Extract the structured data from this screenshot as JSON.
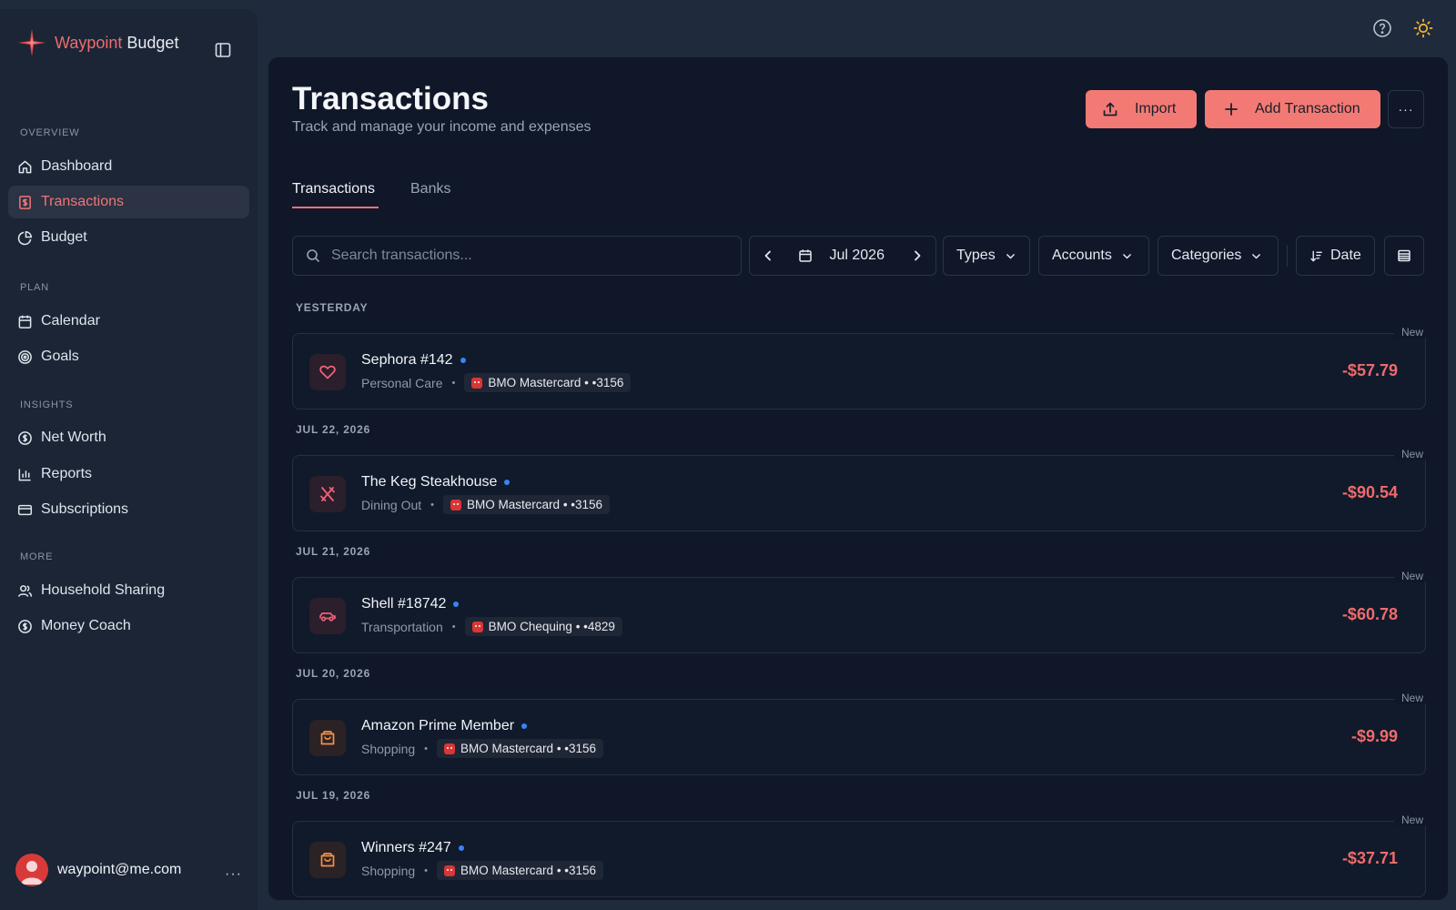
{
  "app": {
    "brand_first": "Waypoint",
    "brand_second": "Budget"
  },
  "sidebar": {
    "sections": [
      {
        "title": "OVERVIEW",
        "items": [
          {
            "label": "Dashboard",
            "icon": "home-icon"
          },
          {
            "label": "Transactions",
            "icon": "receipt-icon",
            "active": true
          },
          {
            "label": "Budget",
            "icon": "pie-chart-icon"
          }
        ]
      },
      {
        "title": "PLAN",
        "items": [
          {
            "label": "Calendar",
            "icon": "calendar-icon"
          },
          {
            "label": "Goals",
            "icon": "target-icon"
          }
        ]
      },
      {
        "title": "INSIGHTS",
        "items": [
          {
            "label": "Net Worth",
            "icon": "dollar-circle-icon"
          },
          {
            "label": "Reports",
            "icon": "bar-chart-icon"
          },
          {
            "label": "Subscriptions",
            "icon": "credit-card-icon"
          }
        ]
      },
      {
        "title": "MORE",
        "items": [
          {
            "label": "Household Sharing",
            "icon": "users-icon"
          },
          {
            "label": "Money Coach",
            "icon": "dollar-circle-icon"
          }
        ]
      }
    ],
    "user_email": "waypoint@me.com",
    "user_more": "···"
  },
  "header": {
    "title": "Transactions",
    "subtitle": "Track and manage your income and expenses",
    "import_label": "Import",
    "add_label": "Add Transaction",
    "more_label": "···"
  },
  "tabs": [
    "Transactions",
    "Banks"
  ],
  "filters": {
    "search_placeholder": "Search transactions...",
    "month": "Jul 2026",
    "types": "Types",
    "accounts": "Accounts",
    "categories": "Categories",
    "sort": "Date"
  },
  "colors": {
    "accent": "#f37a74",
    "amount": "#ef6b6b",
    "unread_dot": "#3b82f6",
    "icon_pink": "#f0617a",
    "icon_orange": "#f39148"
  },
  "groups": [
    {
      "label": "YESTERDAY",
      "transactions": [
        {
          "merchant": "Sephora #142",
          "category": "Personal Care",
          "account": "BMO Mastercard",
          "mask": "• •3156",
          "amount": "-$57.79",
          "tag": "New",
          "icon": "heart-icon"
        }
      ]
    },
    {
      "label": "JUL 22, 2026",
      "transactions": [
        {
          "merchant": "The Keg Steakhouse",
          "category": "Dining Out",
          "account": "BMO Mastercard",
          "mask": "• •3156",
          "amount": "-$90.54",
          "tag": "New",
          "icon": "utensils-icon"
        }
      ]
    },
    {
      "label": "JUL 21, 2026",
      "transactions": [
        {
          "merchant": "Shell #18742",
          "category": "Transportation",
          "account": "BMO Chequing",
          "mask": "• •4829",
          "amount": "-$60.78",
          "tag": "New",
          "icon": "car-icon"
        }
      ]
    },
    {
      "label": "JUL 20, 2026",
      "transactions": [
        {
          "merchant": "Amazon Prime Member",
          "category": "Shopping",
          "account": "BMO Mastercard",
          "mask": "• •3156",
          "amount": "-$9.99",
          "tag": "New",
          "icon": "shopping-bag-icon"
        }
      ]
    },
    {
      "label": "JUL 19, 2026",
      "transactions": [
        {
          "merchant": "Winners #247",
          "category": "Shopping",
          "account": "BMO Mastercard",
          "mask": "• •3156",
          "amount": "-$37.71",
          "tag": "New",
          "icon": "shopping-bag-icon"
        }
      ]
    }
  ]
}
